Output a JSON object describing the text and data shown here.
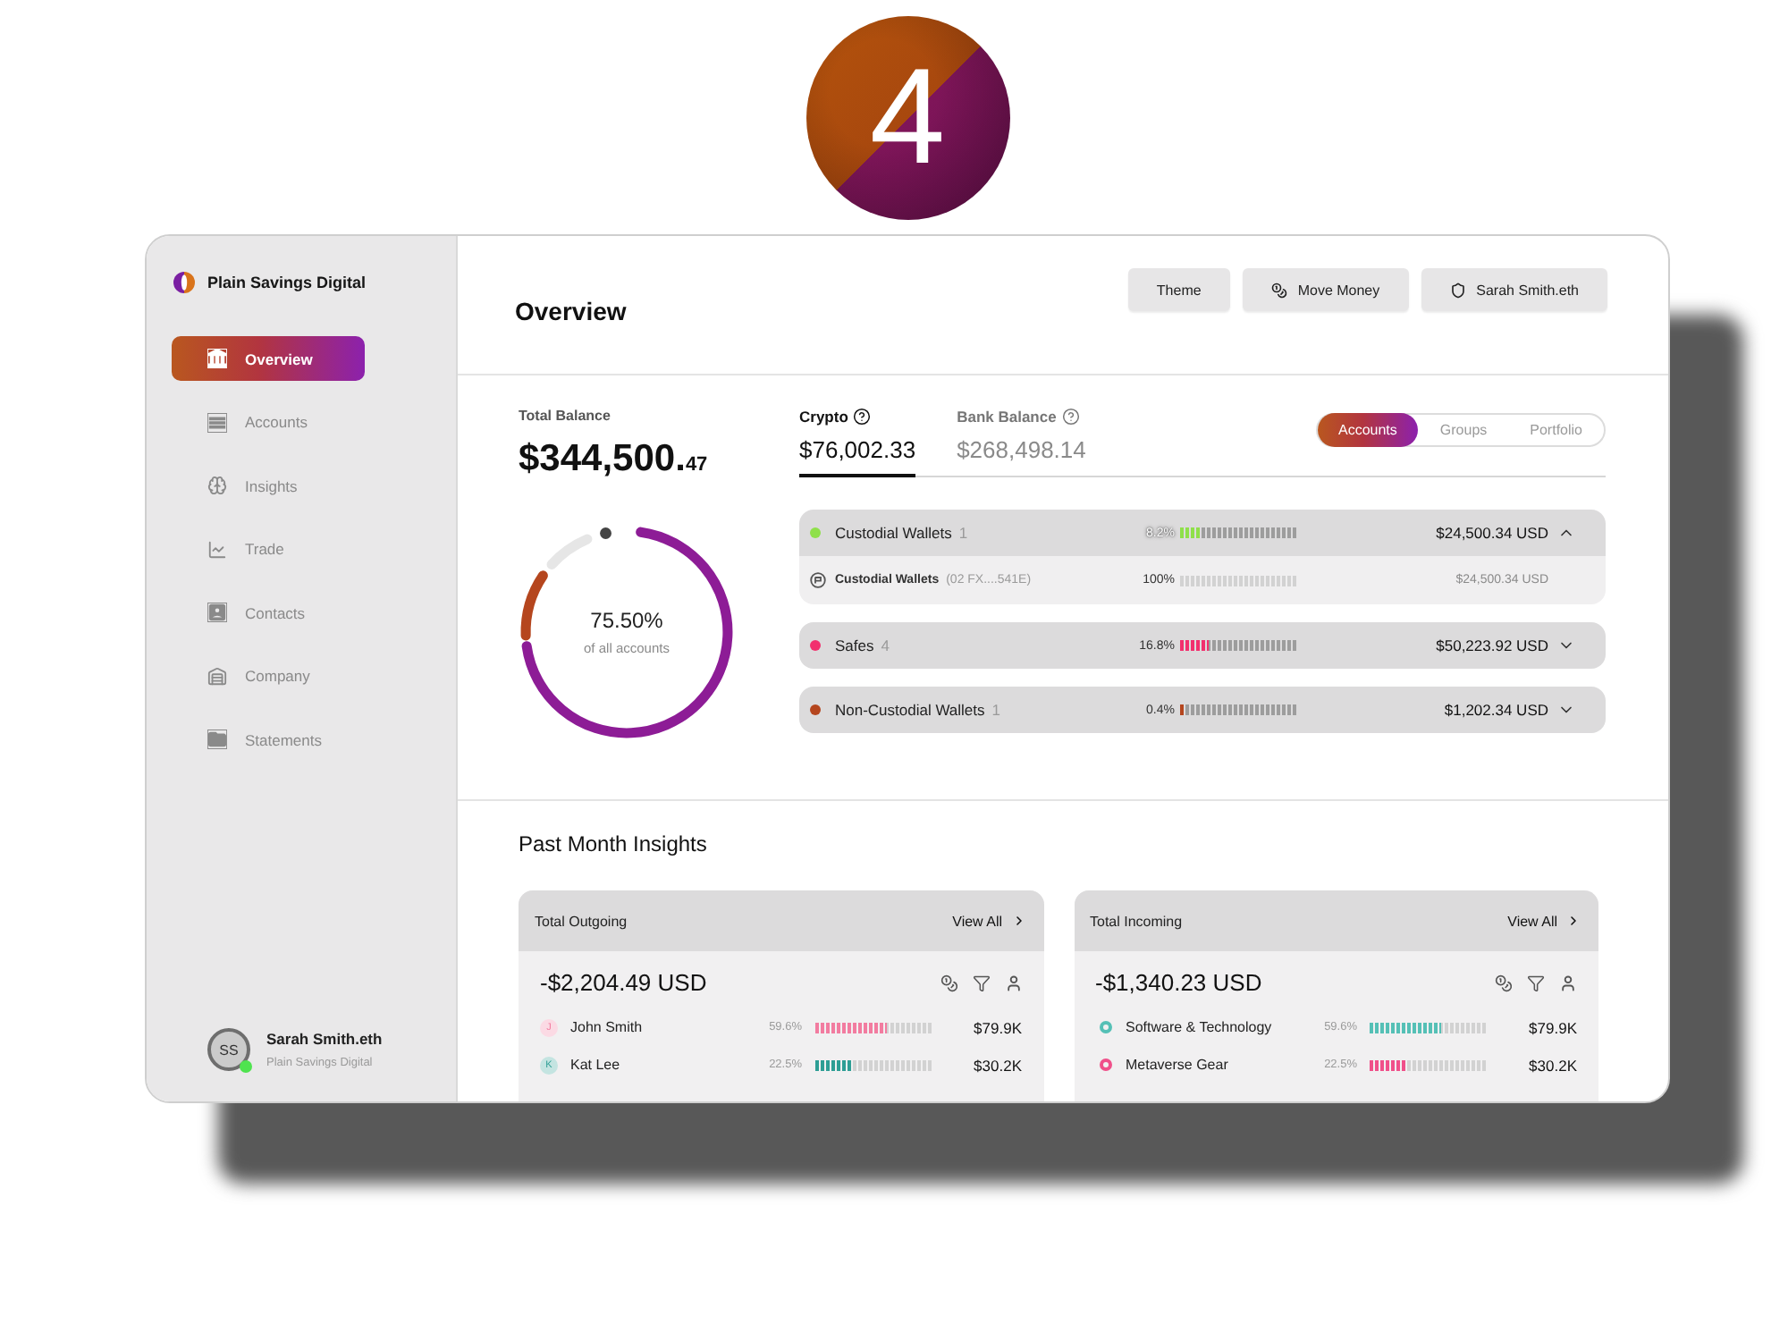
{
  "step_badge": {
    "label": "4"
  },
  "sidebar": {
    "brand": "Plain Savings Digital",
    "items": [
      {
        "label": "Overview",
        "selected": true
      },
      {
        "label": "Accounts",
        "selected": false
      },
      {
        "label": "Insights",
        "selected": false
      },
      {
        "label": "Trade",
        "selected": false
      },
      {
        "label": "Contacts",
        "selected": false
      },
      {
        "label": "Company",
        "selected": false
      },
      {
        "label": "Statements",
        "selected": false
      }
    ],
    "user": {
      "initials": "SS",
      "online": true,
      "name": "Sarah Smith.eth",
      "org": "Plain Savings Digital"
    }
  },
  "header": {
    "title": "Overview",
    "buttons": [
      {
        "label": "Theme"
      },
      {
        "label": "Move Money"
      },
      {
        "label": "Sarah Smith.eth"
      }
    ]
  },
  "balance": {
    "label": "Total Balance",
    "whole": "$344,500.",
    "cents": "47"
  },
  "donut": {
    "reading": "75.50%",
    "caption": "of all accounts"
  },
  "balance_tabs": [
    {
      "label": "Crypto",
      "amount": "$76,002.33",
      "selected": true
    },
    {
      "label": "Bank Balance",
      "amount": "$268,498.14",
      "selected": false
    }
  ],
  "view_toggle": [
    {
      "label": "Accounts",
      "selected": true
    },
    {
      "label": "Groups",
      "selected": false
    },
    {
      "label": "Portfolio",
      "selected": false
    }
  ],
  "accounts": [
    {
      "name": "Custodial Wallets",
      "count": "1",
      "color": "#8fe04a",
      "share": "8.2%",
      "level": 0.17,
      "amount": "$24,500.34 USD",
      "expanded": true,
      "children": [
        {
          "name": "Custodial Wallets",
          "address": "(02 FX....541E)",
          "share": "100%",
          "amount": "$24,500.34 USD"
        }
      ]
    },
    {
      "name": "Safes",
      "count": "4",
      "color": "#f2306e",
      "share": "16.8%",
      "level": 0.245,
      "amount": "$50,223.92 USD",
      "expanded": false
    },
    {
      "name": "Non-Custodial Wallets",
      "count": "1",
      "color": "#b5461e",
      "share": "0.4%",
      "level": 0.04,
      "amount": "$1,202.34 USD",
      "expanded": false
    }
  ],
  "insights": {
    "title": "Past Month Insights",
    "cards": [
      {
        "title": "Total Outgoing",
        "link": "View All",
        "total": "-$2,204.49 USD",
        "rows": [
          {
            "kind": "person",
            "initial": "J",
            "name": "John Smith",
            "color": "#f27ca0",
            "share": "59.6%",
            "level": 0.62,
            "amount": "$79.9K"
          },
          {
            "kind": "person",
            "initial": "K",
            "name": "Kat Lee",
            "color": "#2e9e95",
            "share": "22.5%",
            "level": 0.32,
            "amount": "$30.2K"
          }
        ]
      },
      {
        "title": "Total Incoming",
        "link": "View All",
        "total": "-$1,340.23 USD",
        "rows": [
          {
            "kind": "category",
            "name": "Software & Technology",
            "color": "#55c0b6",
            "share": "59.6%",
            "level": 0.6,
            "amount": "$79.9K"
          },
          {
            "kind": "category",
            "name": "Metaverse Gear",
            "color": "#f0508a",
            "share": "22.5%",
            "level": 0.32,
            "amount": "$30.2K"
          }
        ]
      }
    ]
  }
}
